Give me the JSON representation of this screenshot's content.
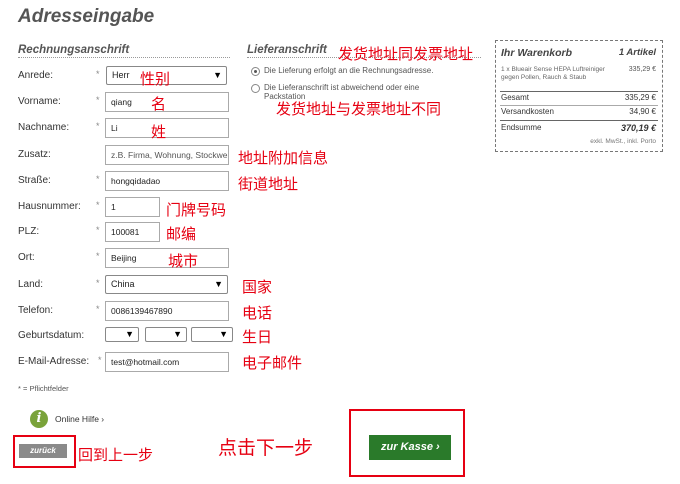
{
  "page": {
    "title": "Adresseingabe"
  },
  "billing": {
    "title": "Rechnungsanschrift",
    "labels": {
      "anrede": "Anrede:",
      "vorname": "Vorname:",
      "nachname": "Nachname:",
      "zusatz": "Zusatz:",
      "strasse": "Straße:",
      "hausnummer": "Hausnummer:",
      "plz": "PLZ:",
      "ort": "Ort:",
      "land": "Land:",
      "telefon": "Telefon:",
      "geburtsdatum": "Geburtsdatum:",
      "email": "E-Mail-Adresse:"
    },
    "required_mark": "*",
    "values": {
      "anrede": "Herr",
      "vorname": "qiang",
      "nachname": "Li",
      "zusatz": "z.B. Firma, Wohnung, Stockwerk",
      "strasse": "hongqidadao",
      "hausnummer": "1",
      "plz": "100081",
      "ort": "Beijing",
      "land": "China",
      "telefon": "0086139467890",
      "email": "test@hotmail.com"
    },
    "required_note": "* = Pflichtfelder"
  },
  "shipping": {
    "title": "Lieferanschrift",
    "options": [
      "Die Lieferung erfolgt an die Rechnungsadresse.",
      "Die Lieferanschrift ist abweichend oder eine Packstation"
    ],
    "selected_index": 0
  },
  "cart": {
    "title": "Ihr Warenkorb",
    "count": "1 Artikel",
    "item": "1 x Blueair Sense HEPA Luftreiniger gegen Pollen, Rauch & Staub",
    "item_price": "335,29 €",
    "rows": [
      {
        "label": "Gesamt",
        "value": "335,29 €"
      },
      {
        "label": "Versandkosten",
        "value": "34,90 €"
      }
    ],
    "total_label": "Endsumme",
    "total_value": "370,19 €",
    "vat_note": "exkl. MwSt., inkl. Porto"
  },
  "help": {
    "label": "Online Hilfe",
    "icon": "info-icon"
  },
  "buttons": {
    "back": "zurück",
    "next": "zur Kasse"
  },
  "annotations": {
    "shipping_same": "发货地址同发票地址",
    "shipping_diff": "发货地址与发票地址不同",
    "gender": "性别",
    "first_name": "名",
    "last_name": "姓",
    "addition": "地址附加信息",
    "street": "街道地址",
    "house_number": "门牌号码",
    "zip": "邮编",
    "city": "城市",
    "country": "国家",
    "phone": "电话",
    "birthday": "生日",
    "email": "电子邮件",
    "back": "回到上一步",
    "next": "点击下一步"
  },
  "colors": {
    "annotation": "#e60012",
    "next_button": "#2a7a2a",
    "back_button": "#8a8a8a"
  }
}
